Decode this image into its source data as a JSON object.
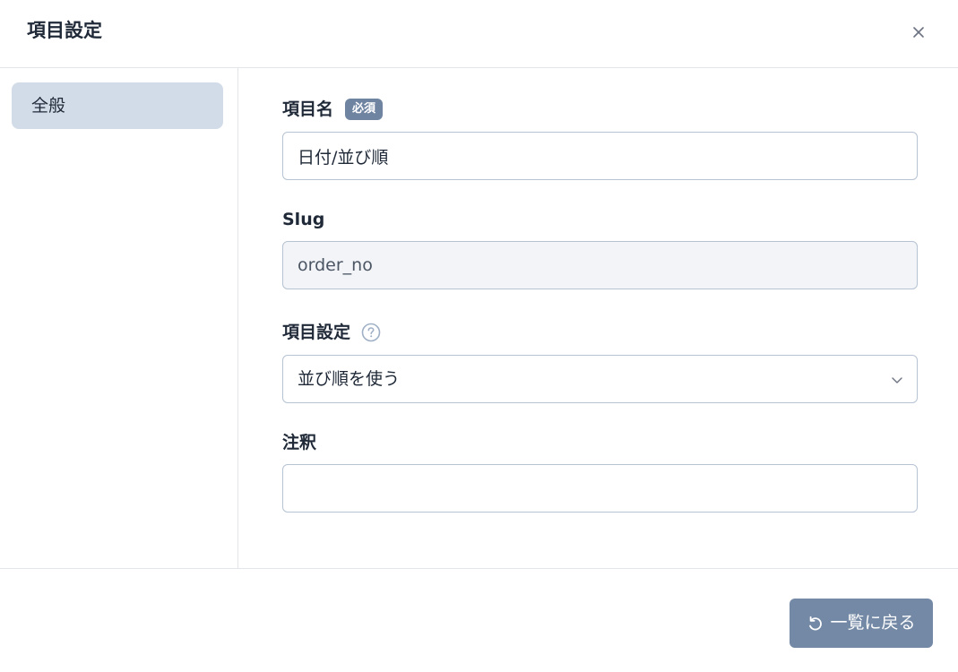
{
  "dialog": {
    "title": "項目設定",
    "close_icon": "close-icon"
  },
  "sidebar": {
    "items": [
      {
        "label": "全般",
        "active": true
      }
    ]
  },
  "form": {
    "name": {
      "label": "項目名",
      "required_badge": "必須",
      "value": "日付/並び順"
    },
    "slug": {
      "label": "Slug",
      "value": "order_no"
    },
    "setting": {
      "label": "項目設定",
      "help_icon": "question-circle-icon",
      "selected": "並び順を使う"
    },
    "note": {
      "label": "注釈",
      "value": ""
    }
  },
  "footer": {
    "back_label": "一覧に戻る",
    "back_icon": "undo-icon"
  },
  "colors": {
    "accent_button": "#7489a5",
    "sidebar_active": "#d2dce8",
    "badge": "#6f84a1",
    "border": "#b6c3d3"
  }
}
